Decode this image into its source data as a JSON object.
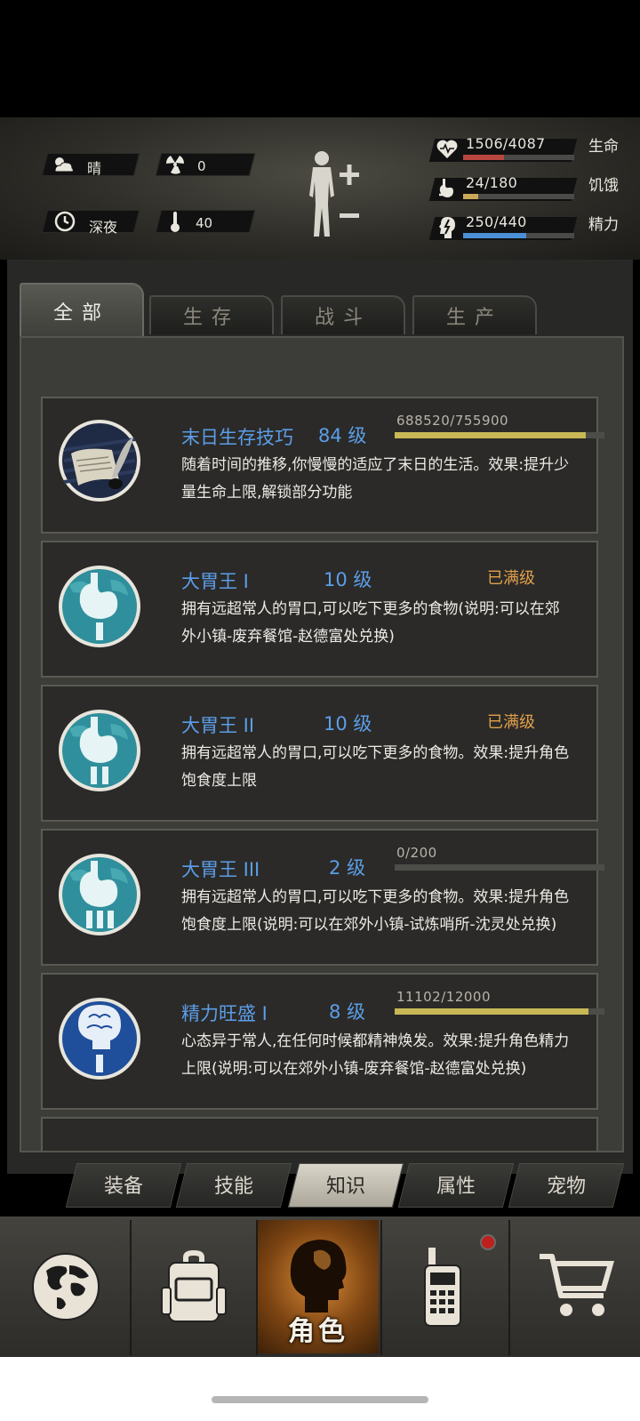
{
  "status": {
    "weather": {
      "icon": "sun-cloud-icon",
      "label": "晴"
    },
    "radiation": {
      "icon": "radiation-icon",
      "value": "0"
    },
    "time": {
      "icon": "clock-icon",
      "label": "深夜"
    },
    "temperature": {
      "icon": "thermometer-icon",
      "value": "40"
    }
  },
  "vitals": [
    {
      "id": "health",
      "icon": "heart-pulse-icon",
      "value": "1506/4087",
      "label": "生命",
      "fraction": 0.368,
      "color": "#b8463e"
    },
    {
      "id": "hunger",
      "icon": "stomach-icon",
      "value": "24/180",
      "label": "饥饿",
      "fraction": 0.133,
      "color": "#c9a85a"
    },
    {
      "id": "energy",
      "icon": "brain-icon",
      "value": "250/440",
      "label": "精力",
      "fraction": 0.568,
      "color": "#4b8fd6"
    }
  ],
  "category_tabs": [
    {
      "label": "全部",
      "active": true
    },
    {
      "label": "生存",
      "active": false
    },
    {
      "label": "战斗",
      "active": false
    },
    {
      "label": "生产",
      "active": false
    }
  ],
  "knowledge": [
    {
      "icon": "scroll-quill-icon",
      "name": "末日生存技巧",
      "level": "84 级",
      "xp": "688520/755900",
      "progress": 0.911,
      "maxed": false,
      "desc_line1": "随着时间的推移,你慢慢的适应了末日的生活。效果:提升少",
      "desc_line2": "量生命上限,解锁部分功能"
    },
    {
      "icon": "stomach-badge-icon",
      "name": "大胃王 I",
      "level": "10 级",
      "max_label": "已满级",
      "maxed": true,
      "desc_line1": "拥有远超常人的胃口,可以吃下更多的食物(说明:可以在郊",
      "desc_line2": "外小镇-废弃餐馆-赵德富处兑换)"
    },
    {
      "icon": "stomach-badge-icon",
      "name": "大胃王 II",
      "level": "10 级",
      "max_label": "已满级",
      "maxed": true,
      "desc_line1": "拥有远超常人的胃口,可以吃下更多的食物。效果:提升角色",
      "desc_line2": "饱食度上限"
    },
    {
      "icon": "stomach-badge-icon",
      "name": "大胃王 III",
      "level": "2 级",
      "xp": "0/200",
      "progress": 0.0,
      "maxed": false,
      "desc_line1": "拥有远超常人的胃口,可以吃下更多的食物。效果:提升角色",
      "desc_line2": "饱食度上限(说明:可以在郊外小镇-试炼哨所-沈灵处兑换)"
    },
    {
      "icon": "brain-badge-icon",
      "name": "精力旺盛 I",
      "level": "8 级",
      "xp": "11102/12000",
      "progress": 0.925,
      "maxed": false,
      "desc_line1": "心态异于常人,在任何时候都精神焕发。效果:提升角色精力",
      "desc_line2": "上限(说明:可以在郊外小镇-废弃餐馆-赵德富处兑换)"
    }
  ],
  "sub_tabs": [
    {
      "label": "装备",
      "active": false
    },
    {
      "label": "技能",
      "active": false
    },
    {
      "label": "知识",
      "active": true
    },
    {
      "label": "属性",
      "active": false
    },
    {
      "label": "宠物",
      "active": false
    }
  ],
  "bottom_nav": [
    {
      "icon": "globe-icon"
    },
    {
      "icon": "backpack-icon"
    },
    {
      "icon": "head-silhouette-icon",
      "label": "角色",
      "active": true
    },
    {
      "icon": "walkie-talkie-icon",
      "notification": true
    },
    {
      "icon": "shopping-cart-icon"
    }
  ]
}
